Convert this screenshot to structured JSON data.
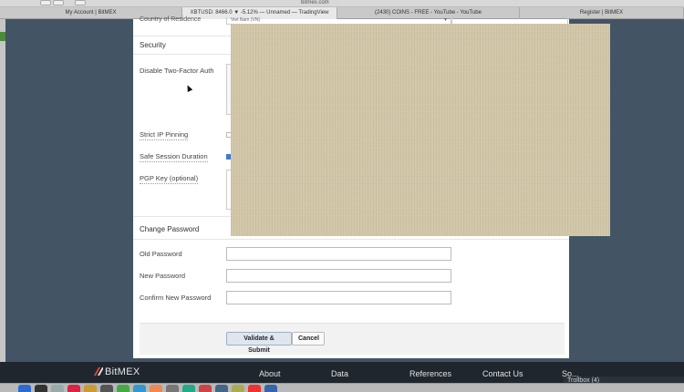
{
  "browser": {
    "url_fragment": "bitmex.com",
    "tabs": [
      {
        "label": "My Account | BitMEX",
        "active": false
      },
      {
        "label": "XBTUSD: 8466.0 ▼ -5.12% — Unnamed — TradingView",
        "active": true
      },
      {
        "label": "(2430) COINS - FREE - YouTube - YouTube",
        "active": false
      },
      {
        "label": "Register | BitMEX",
        "active": false
      }
    ]
  },
  "form": {
    "partial_row_label": "Country of Residence",
    "partial_select_value": "Viet Nam (VN)",
    "security_title": "Security",
    "tfa_label": "Disable Two-Factor Auth",
    "ip_pinning_label": "Strict IP Pinning",
    "ip_pinning_checked": false,
    "session_label": "Safe Session Duration",
    "session_checked": true,
    "pgp_label": "PGP Key (optional)",
    "password_title": "Change Password",
    "old_password_label": "Old Password",
    "new_password_label": "New Password",
    "confirm_password_label": "Confirm New Password",
    "submit_label": "Validate & Submit",
    "cancel_label": "Cancel"
  },
  "footer": {
    "logo_text": "BitMEX",
    "links": [
      "About",
      "Data",
      "References",
      "Contact Us",
      "So..."
    ],
    "trollbox_label": "Trollbox (4)"
  },
  "colors": {
    "page_bg": "#435465",
    "footer_bg": "#1f262e",
    "checkbox_accent": "#3b7bd6",
    "overlay": "#d2c6a6"
  }
}
